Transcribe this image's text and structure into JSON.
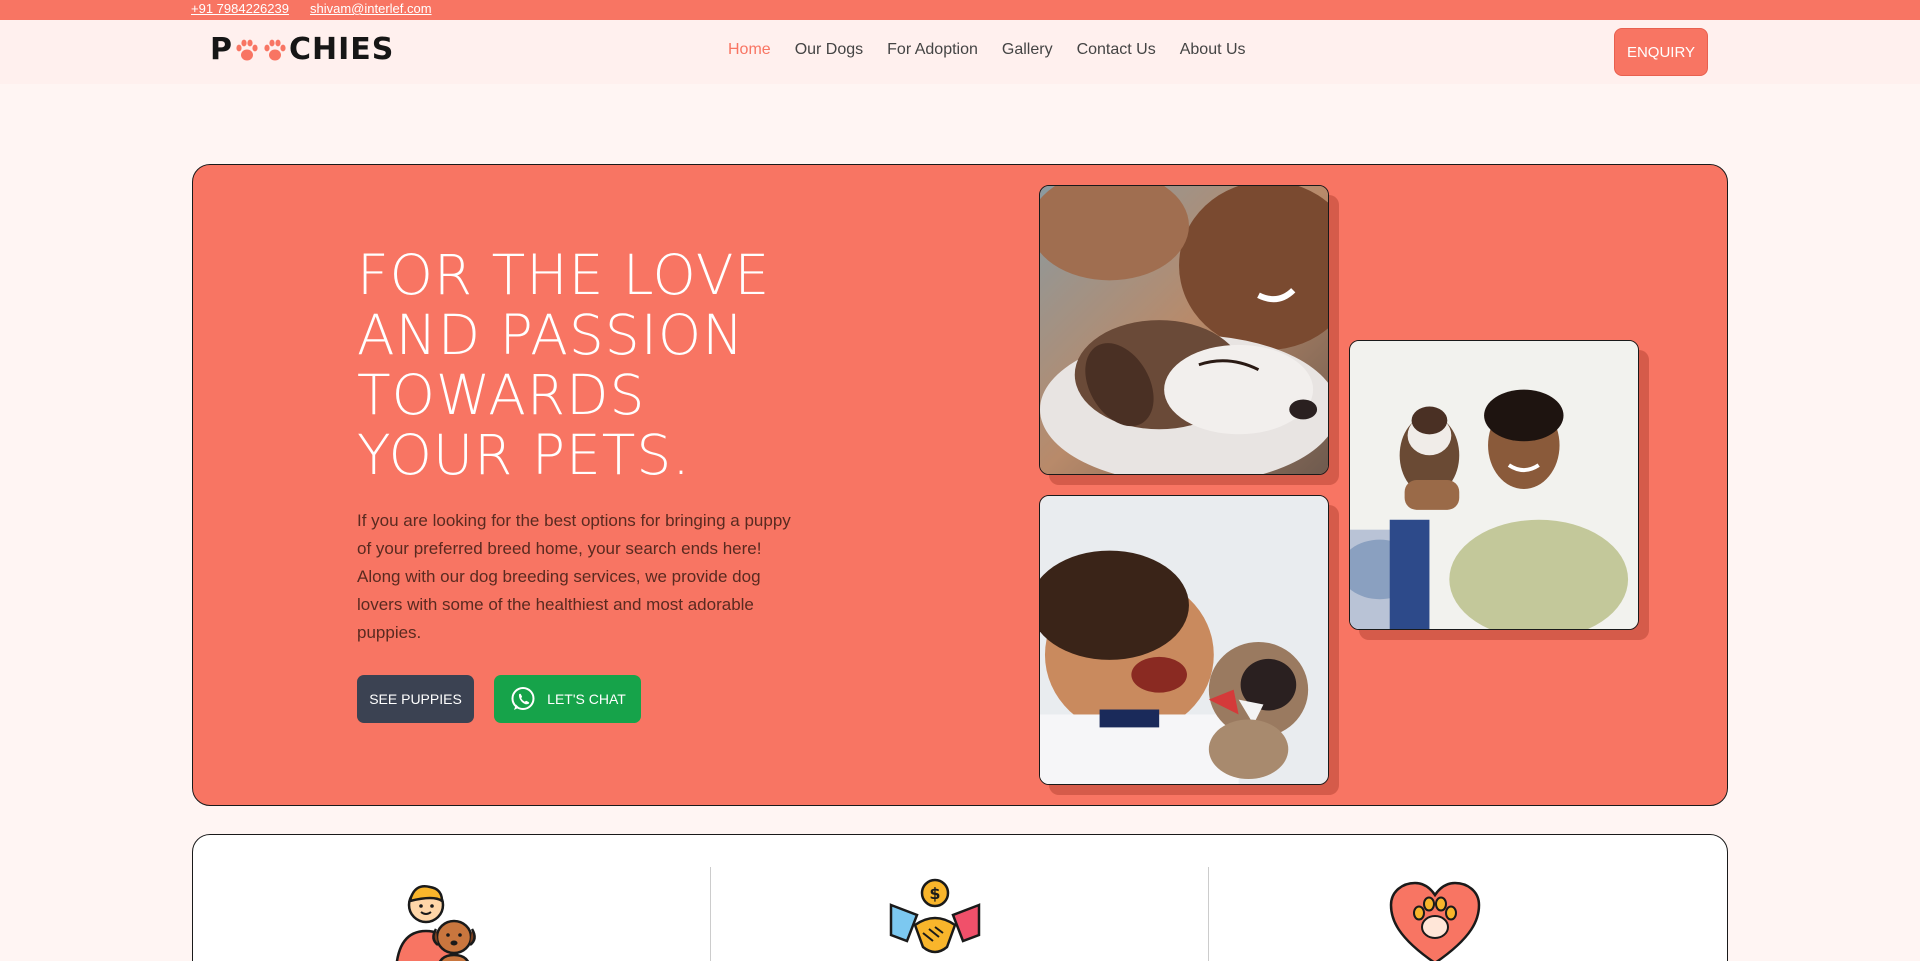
{
  "topbar": {
    "phone": "+91 7984226239",
    "email": "shivam@interlef.com"
  },
  "header": {
    "logo_prefix": "P",
    "logo_suffix": "CHIES",
    "nav": [
      {
        "label": "Home",
        "active": true
      },
      {
        "label": "Our Dogs",
        "active": false
      },
      {
        "label": "For Adoption",
        "active": false
      },
      {
        "label": "Gallery",
        "active": false
      },
      {
        "label": "Contact Us",
        "active": false
      },
      {
        "label": "About Us",
        "active": false
      }
    ],
    "enquiry_label": "ENQUIRY"
  },
  "hero": {
    "title_lines": [
      "FOR THE LOVE",
      "AND PASSION",
      "TOWARDS",
      "YOUR PETS."
    ],
    "description": "If you are looking for the best options for bringing a puppy of your preferred breed home, your search ends here! Along with our dog breeding services, we provide dog lovers with some of the healthiest and most adorable puppies.",
    "see_puppies_label": "SEE PUPPIES",
    "chat_label": "LET'S CHAT",
    "chat_icon": "whatsapp-icon"
  },
  "features": {
    "icons": [
      "boy-with-dog-icon",
      "handshake-dollar-icon",
      "heart-paw-icon"
    ]
  },
  "colors": {
    "accent": "#f87563",
    "dark_button": "#3b4252",
    "chat_green": "#16a34a",
    "page_bg": "#fff5f3"
  }
}
